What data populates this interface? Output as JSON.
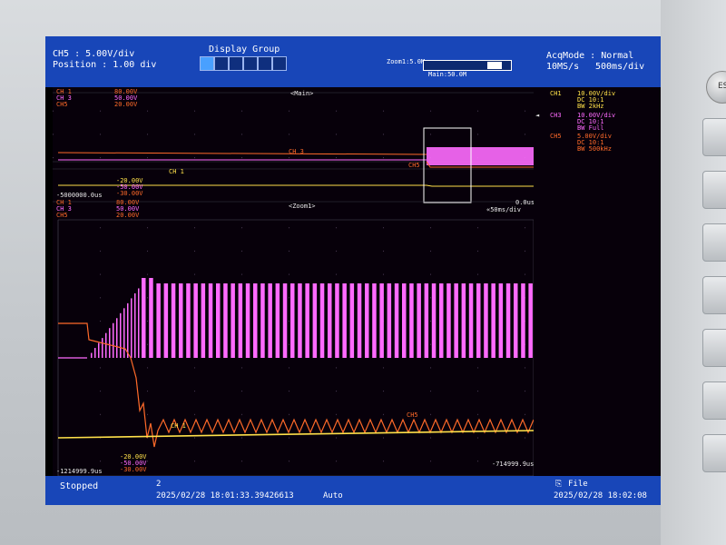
{
  "header": {
    "ch_label": "CH5 : 5.00V/div",
    "position": "Position : 1.00 div",
    "display_group": "Display Group",
    "zoom": "Zoom1:5.0M",
    "main_len": "Main:50.0M",
    "acq_mode": "AcqMode : Normal",
    "sample_rate": "10MS/s",
    "time_div": "500ms/div"
  },
  "main_window": {
    "label": "<Main>",
    "ch_levels": [
      {
        "name": "CH 1",
        "value": "80.00V"
      },
      {
        "name": "CH 3",
        "value": "50.00V"
      },
      {
        "name": "CH5",
        "value": "20.00V"
      }
    ],
    "time_start": "-5000000.0us",
    "time_end": "0.0us",
    "lower_levels": [
      "-20.00V",
      "-50.00V",
      "-30.00V"
    ],
    "trace_label_ch3": "CH 3",
    "trace_label_ch1": "CH 1",
    "trace_label_ch5": "CH5"
  },
  "zoom_window": {
    "label": "<Zoom1>",
    "time_div": "«50ms/div",
    "ch_levels": [
      {
        "name": "CH 1",
        "value": "80.00V"
      },
      {
        "name": "CH 3",
        "value": "50.00V"
      },
      {
        "name": "CH5",
        "value": "20.00V"
      }
    ],
    "lower_levels": [
      "-20.00V",
      "-50.00V",
      "-30.00V"
    ],
    "time_start": "-1214999.9us",
    "time_end": "-714999.9us",
    "trace_label_ch1": "CH 1",
    "trace_label_ch5": "CH5"
  },
  "side_panel": {
    "ch1": {
      "name": "CH1",
      "vdiv": "10.00V/div",
      "coupling": "DC  10:1",
      "bw": "BW 2kHz"
    },
    "ch3": {
      "name": "CH3",
      "vdiv": "10.00V/div",
      "coupling": "DC  10:1",
      "bw": "BW Full"
    },
    "ch5": {
      "name": "CH5",
      "vdiv": "5.00V/div",
      "coupling": "DC  10:1",
      "bw": "BW 500kHz"
    }
  },
  "footer": {
    "status": "Stopped",
    "count": "2",
    "trigger_time": "2025/02/28  18:01:33.39426613",
    "trigger_mode": "Auto",
    "file_label": "File",
    "clock": "2025/02/28  18:02:08"
  },
  "bezel": {
    "button_label": "ES"
  },
  "colors": {
    "ch1": "#ffe14a",
    "ch3": "#ff6bff",
    "ch5": "#ff6a2a",
    "header": "#1846b8"
  }
}
